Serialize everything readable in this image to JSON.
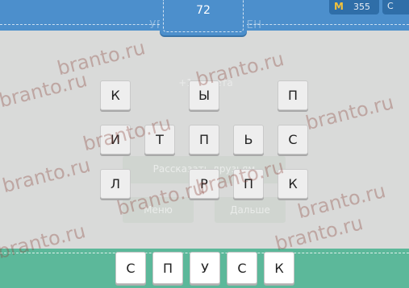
{
  "header": {
    "level_number": "72",
    "level_passed_text": "УРОВЕНЬ ПРОЙДЕН",
    "coins": {
      "icon": "coin-m-icon",
      "symbol": "M",
      "count": "355"
    },
    "extra_label": "С"
  },
  "overlay": {
    "reward_text": "+1 монета",
    "reward_coin_symbol": "M",
    "tell_friends_label": "Рассказать друзьям",
    "menu_label": "Меню",
    "next_label": "Дальше"
  },
  "letter_grid": {
    "rows": [
      [
        "К",
        "",
        "Ы",
        "",
        "П"
      ],
      [
        "И",
        "Т",
        "П",
        "Ь",
        "С"
      ],
      [
        "Л",
        "",
        "Р",
        "П",
        "К"
      ]
    ]
  },
  "answer": {
    "letters": [
      "С",
      "П",
      "У",
      "С",
      "К"
    ]
  },
  "watermark": {
    "text": "branto.ru"
  },
  "colors": {
    "header_blue": "#4c8fcc",
    "answer_bar_green": "#5cb89a",
    "background_gray": "#d9dad9",
    "coin_gold": "#f3c23b"
  }
}
